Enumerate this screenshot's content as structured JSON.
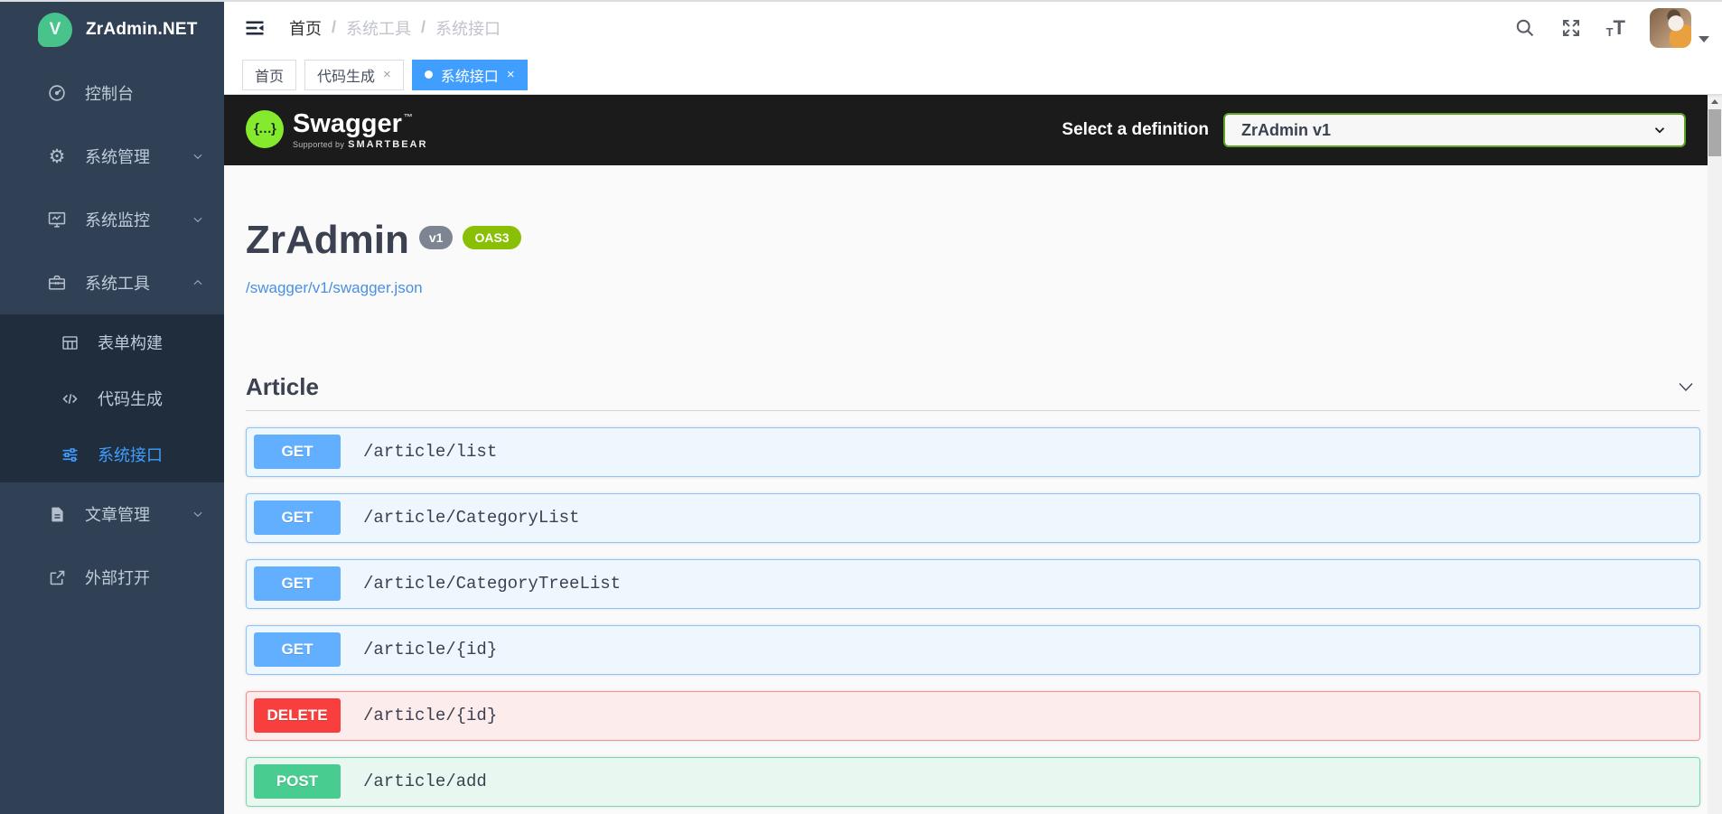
{
  "sidebar": {
    "logo_letter": "V",
    "logo_text": "ZrAdmin.NET",
    "items": {
      "dashboard": {
        "label": "控制台"
      },
      "system_manage": {
        "label": "系统管理"
      },
      "system_monitor": {
        "label": "系统监控"
      },
      "system_tools": {
        "label": "系统工具"
      },
      "form_builder": {
        "label": "表单构建"
      },
      "code_gen": {
        "label": "代码生成"
      },
      "system_api": {
        "label": "系统接口"
      },
      "article_manage": {
        "label": "文章管理"
      },
      "external_open": {
        "label": "外部打开"
      }
    }
  },
  "header": {
    "breadcrumb": {
      "home": "首页",
      "sep1": "/",
      "tools": "系统工具",
      "sep2": "/",
      "api": "系统接口"
    },
    "font_icon": {
      "small_t": "T",
      "big_t": "T"
    }
  },
  "tabs": {
    "home": {
      "label": "首页"
    },
    "codegen": {
      "label": "代码生成",
      "close": "×"
    },
    "api": {
      "label": "系统接口",
      "close": "×"
    }
  },
  "swagger": {
    "topbar": {
      "logo_glyph": "{…}",
      "logo_text": "Swagger",
      "trademark": "™",
      "supported_by": "Supported by",
      "brand": "SMARTBEAR",
      "select_label": "Select a definition",
      "selected_value": "ZrAdmin v1"
    },
    "info": {
      "title": "ZrAdmin",
      "version_badge": "v1",
      "oas_badge": "OAS3",
      "spec_url": "/swagger/v1/swagger.json"
    },
    "section_title": "Article",
    "endpoints": [
      {
        "method": "GET",
        "path": "/article/list"
      },
      {
        "method": "GET",
        "path": "/article/CategoryList"
      },
      {
        "method": "GET",
        "path": "/article/CategoryTreeList"
      },
      {
        "method": "GET",
        "path": "/article/{id}"
      },
      {
        "method": "DELETE",
        "path": "/article/{id}"
      },
      {
        "method": "POST",
        "path": "/article/add"
      }
    ]
  },
  "colors": {
    "accent": "#409EFF",
    "sidebar_bg": "#304156",
    "submenu_bg": "#1f2d3d",
    "swagger_topbar_bg": "#1b1b1b",
    "method_get": "#61affe",
    "method_post": "#49cc90",
    "method_delete": "#f93e3e",
    "oas_badge": "#89bf04",
    "version_badge": "#7d8492"
  }
}
